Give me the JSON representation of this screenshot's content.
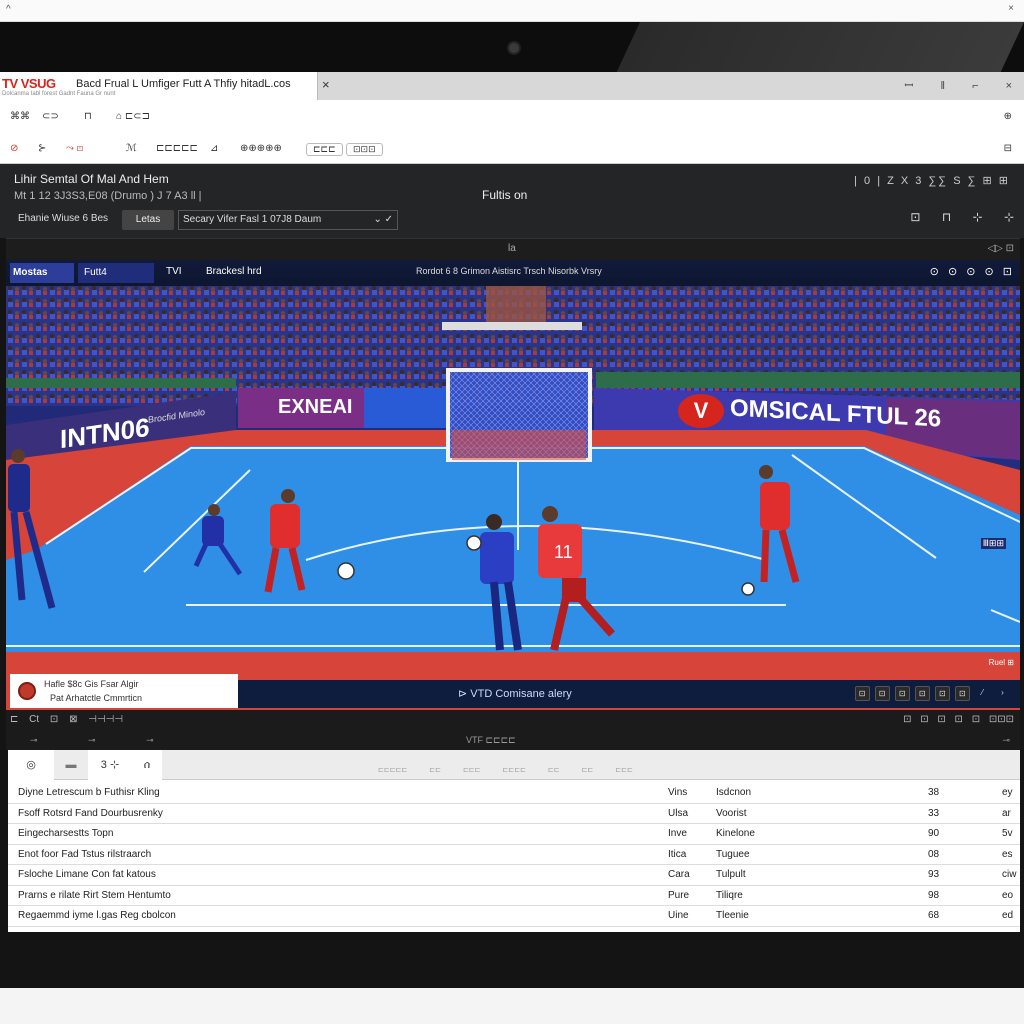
{
  "top_strip": {
    "left_glyph": "^",
    "right_glyph": "×"
  },
  "browser": {
    "tab_logo": "TV VSUG",
    "tab_title": "Bacd Frual L Umfiger Futt A Thfiy hitadL.cos",
    "tab_subtitle": "Dolcanma tabl forest Gadnt Fauna Gr nunt",
    "tab_close": "×",
    "window_controls": [
      "ꟷ",
      "ǁ",
      "⌐",
      "×"
    ]
  },
  "toolbar": {
    "row1": [
      "⌘⌘",
      "⊂⊃",
      "⊓",
      "⌂ ⊏⊂⊐"
    ],
    "row1_right": "⊕",
    "row2": [
      "⊘",
      "⊱",
      "⤳ ⊡",
      "ℳ",
      "⊏⊏⊏⊏⊏",
      "⊿",
      "⊕⊕⊕⊕⊕",
      "⊏⊏⊏",
      "⊡⊡⊡"
    ],
    "row2_right": "⊟"
  },
  "app": {
    "title": "Lihir Semtal Of Mal And Hem",
    "meta": "Mt 1 12    3J3S3,E08  (Drumo  )   J  7 A3  ll  |",
    "center_label": "Fultis on",
    "right_meta": "| 0 |  Z X  3  ∑∑  S  ∑  ⊞ ⊞",
    "filter_label": "Ehanie Wiuse 6 Bes",
    "filter_button": "Letas",
    "filter_select": "Secary Vifer Fasl 1 07J8 Daum",
    "header_icons": [
      "⊡",
      "⊓",
      "⊹",
      "⊹"
    ]
  },
  "subbar": {
    "center": "la",
    "right": "◁▷ ⊡"
  },
  "video": {
    "channel_logo": "Mostas",
    "channel_2": "Futt4",
    "channel_tvd": "TVI",
    "channel_brand": "Brackesl hrd",
    "channel_mid": "Rordot 6 8 Grimon Aistisrc Trsch Nisorbk Vrsry",
    "channel_icons": [
      "⊙",
      "⊙",
      "⊙",
      "⊙",
      "⊡"
    ],
    "ad_left": "INTN06",
    "ad_left_small": "Brocfid Minolo",
    "ad_center": "EXNEAI",
    "ad_right": "OMSICAL FTUL 26",
    "ad_right_logo": "V",
    "player_number": "11",
    "side_label_right": "Ⅲ⊞⊞",
    "side_label_right2": "Ruel ⊞"
  },
  "scorebox": {
    "line1": "Hafle   $8c Gis   Fsar   Algir",
    "line2": "Pat Arhatctle    Cmmrticn"
  },
  "caption_bar": {
    "caption": "⊳ VTD  Comisane alery",
    "buttons": [
      "⊡",
      "⊡",
      "⊡",
      "⊡",
      "⊡",
      "⊡",
      "⁄",
      "›"
    ]
  },
  "controls": {
    "left": "⊏  Ct  ⊡  ⊠  ⊣⊣⊣⊣",
    "right": "⊡  ⊡  ⊡  ⊡  ⊡  ⊡⊡⊡",
    "row2_left": "⊸ ⊸ ⊸",
    "row2_mid": "VTF    ⊏⊏⊏⊏",
    "row2_right": "⊸"
  },
  "table": {
    "tabs": [
      "◎",
      "▬",
      "3 ⊹",
      "ሰ"
    ],
    "column_headers": "⊏⊏⊏⊏⊏ ⊏⊏ ⊏⊏⊏ ⊏⊏⊏⊏ ⊏⊏ ⊏⊏ ⊏⊏⊏",
    "rows": [
      {
        "name": "Diyne Letrescum b Futhisr Kling",
        "c2": "Vins",
        "c3": "Isdcnon",
        "c4": "38",
        "c5": "ey"
      },
      {
        "name": "Fsoff Rotsrd Fand Dourbusrenky",
        "c2": "Ulsa",
        "c3": "Voorist",
        "c4": "33",
        "c5": "ar"
      },
      {
        "name": "Eingecharsestts Topn",
        "c2": "Inve",
        "c3": "Kinelone",
        "c4": "90",
        "c5": "5v"
      },
      {
        "name": "Enot foor Fad Tstus rilstraarch",
        "c2": "Itica",
        "c3": "Tuguee",
        "c4": "08",
        "c5": "es"
      },
      {
        "name": "Fsloche Limane Con fat katous",
        "c2": "Cara",
        "c3": "Tulpult",
        "c4": "93",
        "c5": "ciw"
      },
      {
        "name": "Prarns e rilate Rirt Stem Hentumto",
        "c2": "Pure",
        "c3": "Tiliqre",
        "c4": "98",
        "c5": "eo"
      },
      {
        "name": "Regaemmd iyme l.gas Reg cbolcon",
        "c2": "Uine",
        "c3": "Tleenie",
        "c4": "68",
        "c5": "ed"
      }
    ]
  }
}
